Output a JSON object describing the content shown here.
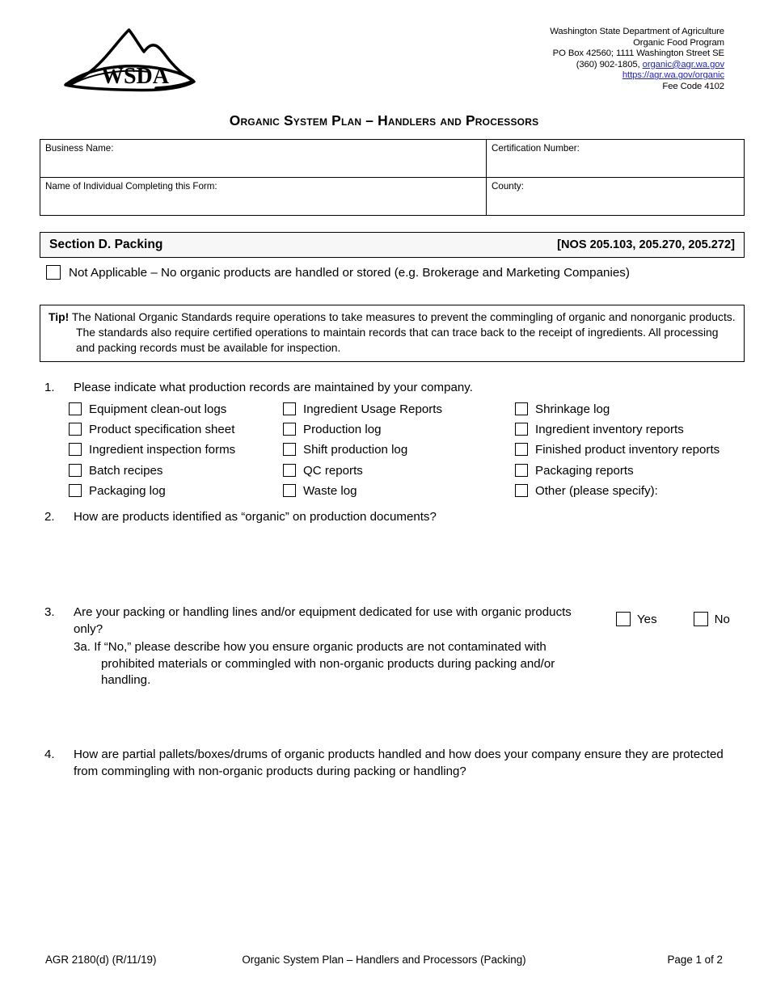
{
  "header": {
    "logo_text": "WSDA",
    "agency_lines": [
      "Washington State Department of Agriculture",
      "Organic Food Program",
      "PO Box 42560; 1111 Washington Street SE"
    ],
    "phone_prefix": "(360) 902-1805, ",
    "email": "organic@agr.wa.gov",
    "website": "https://agr.wa.gov/organic",
    "fee_code": "Fee Code 4102"
  },
  "document": {
    "title": "Organic System Plan – Handlers and Processors"
  },
  "info_fields": {
    "business_name": "Business Name:",
    "certification_number": "Certification Number:",
    "individual_name": "Name of Individual Completing this Form:",
    "county": "County:"
  },
  "section": {
    "label": "Section D.  Packing",
    "citation": "[NOS 205.103, 205.270, 205.272]",
    "not_applicable": "Not Applicable – No organic products are handled or stored (e.g. Brokerage and Marketing Companies)"
  },
  "tip": {
    "label": "Tip!",
    "text": " The National Organic Standards require operations to take measures to prevent the commingling of organic and nonorganic products. The standards also require certified operations to maintain records that can trace back to the receipt of ingredients. All processing and packing records must be available for inspection."
  },
  "questions": {
    "q1": {
      "number": "1.",
      "text": "Please indicate what production records are maintained by your company.",
      "columns": [
        [
          "Equipment clean-out logs",
          "Product specification sheet",
          "Ingredient inspection forms",
          "Batch recipes",
          "Packaging log"
        ],
        [
          "Ingredient Usage Reports",
          "Production log",
          "Shift production log",
          "QC reports",
          "Waste log"
        ],
        [
          "Shrinkage log",
          "Ingredient inventory reports",
          "Finished product inventory reports",
          "Packaging reports",
          "Other (please specify):"
        ]
      ]
    },
    "q2": {
      "number": "2.",
      "text": "How are products identified as “organic” on production documents?"
    },
    "q3": {
      "number": "3.",
      "text": "Are your packing or handling lines and/or equipment dedicated for use with organic products only?",
      "sub_label": "3a.",
      "sub_text": "If “No,” please describe how you ensure organic products are not contaminated with prohibited materials or commingled with non-organic products during packing and/or handling.",
      "yes_label": "Yes",
      "no_label": "No"
    },
    "q4": {
      "number": "4.",
      "text": "How are partial pallets/boxes/drums of organic products handled and how does your company ensure they are protected from commingling with non-organic products during packing or handling?"
    }
  },
  "footer": {
    "form_code": "AGR 2180(d) (R/11/19)",
    "center": "Organic System Plan – Handlers and Processors (Packing)",
    "page": "Page 1 of 2"
  },
  "colors": {
    "link": "#2222cc",
    "section_bg": "#f7f7f7"
  }
}
